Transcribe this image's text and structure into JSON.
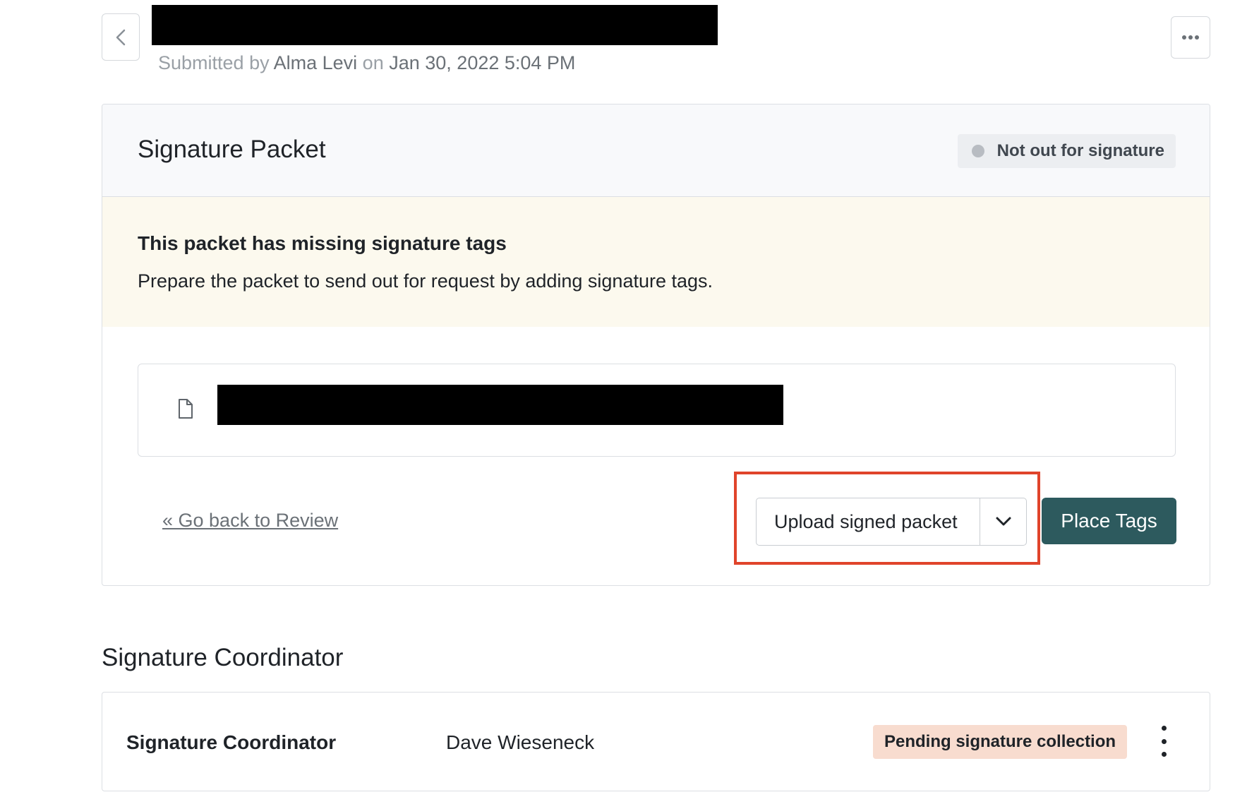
{
  "header": {
    "submitted_prefix": "Submitted by",
    "submitter": "Alma Levi",
    "on_word": "on",
    "submitted_date": "Jan 30, 2022 5:04 PM",
    "back_icon": "chevron-left-icon",
    "more_icon": "ellipsis-icon"
  },
  "packet": {
    "title": "Signature Packet",
    "status": "Not out for signature",
    "status_dot_color": "#b8bcc2",
    "warning_title": "This packet has missing signature tags",
    "warning_text": "Prepare the packet to send out for request by adding signature tags.",
    "warning_bg": "#fcf9ee",
    "file_icon": "document-icon",
    "go_back_link": "« Go back to Review",
    "upload_button": "Upload signed packet",
    "upload_caret_icon": "chevron-down-icon",
    "place_tags_button": "Place Tags",
    "primary_color": "#2d5a5e",
    "highlight_color": "#e0442b"
  },
  "coordinator": {
    "section_title": "Signature Coordinator",
    "role_label": "Signature Coordinator",
    "name": "Dave Wieseneck",
    "status": "Pending signature collection",
    "status_bg": "#f8dccf",
    "menu_icon": "kebab-menu-icon"
  }
}
